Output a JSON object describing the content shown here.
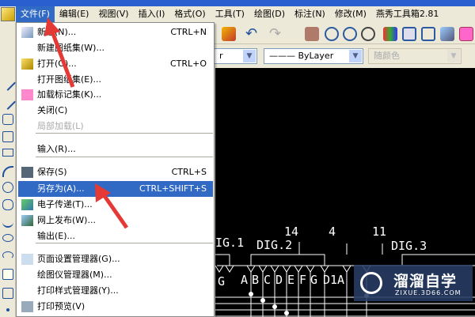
{
  "menubar": {
    "items": [
      "文件(F)",
      "编辑(E)",
      "视图(V)",
      "插入(I)",
      "格式(O)",
      "工具(T)",
      "绘图(D)",
      "标注(N)",
      "修改(M)",
      "燕秀工具箱2.81"
    ]
  },
  "file_menu": {
    "items": [
      {
        "label": "新建(N)...",
        "shortcut": "CTRL+N",
        "icon": "new-file-icon"
      },
      {
        "label": "新建图纸集(W)...",
        "shortcut": ""
      },
      {
        "label": "打开(O)...",
        "shortcut": "CTRL+O",
        "icon": "open-folder-icon"
      },
      {
        "label": "打开图纸集(E)...",
        "shortcut": ""
      },
      {
        "label": "加载标记集(K)...",
        "shortcut": "",
        "icon": "markup-icon"
      },
      {
        "label": "关闭(C)",
        "shortcut": ""
      },
      {
        "label": "局部加载(L)",
        "shortcut": "",
        "disabled": true
      },
      {
        "label": "输入(R)...",
        "shortcut": ""
      },
      {
        "label": "保存(S)",
        "shortcut": "CTRL+S",
        "icon": "save-icon"
      },
      {
        "label": "另存为(A)...",
        "shortcut": "CTRL+SHIFT+S",
        "highlighted": true
      },
      {
        "label": "电子传递(T)...",
        "shortcut": "",
        "icon": "etransmit-icon"
      },
      {
        "label": "网上发布(W)...",
        "shortcut": "",
        "icon": "publish-web-icon"
      },
      {
        "label": "输出(E)...",
        "shortcut": ""
      },
      {
        "label": "页面设置管理器(G)...",
        "shortcut": "",
        "icon": "page-setup-icon"
      },
      {
        "label": "绘图仪管理器(M)...",
        "shortcut": ""
      },
      {
        "label": "打印样式管理器(Y)...",
        "shortcut": ""
      },
      {
        "label": "打印预览(V)",
        "shortcut": "",
        "icon": "print-preview-icon"
      }
    ]
  },
  "toolbar": {
    "layer_combo": "r",
    "linetype_combo": "ByLayer",
    "color_combo": "随颜色"
  },
  "drawing": {
    "labels": [
      "IG.1",
      "DIG.2",
      "14",
      "4",
      "11",
      "DIG.3",
      "G",
      "A",
      "B",
      "C",
      "D",
      "E",
      "F",
      "G",
      "D1A"
    ]
  },
  "watermark": {
    "title": "溜溜自学",
    "url": "ZIXUE.3D66.COM"
  },
  "colors": {
    "highlight": "#316ac5",
    "arrow": "#e53935"
  }
}
